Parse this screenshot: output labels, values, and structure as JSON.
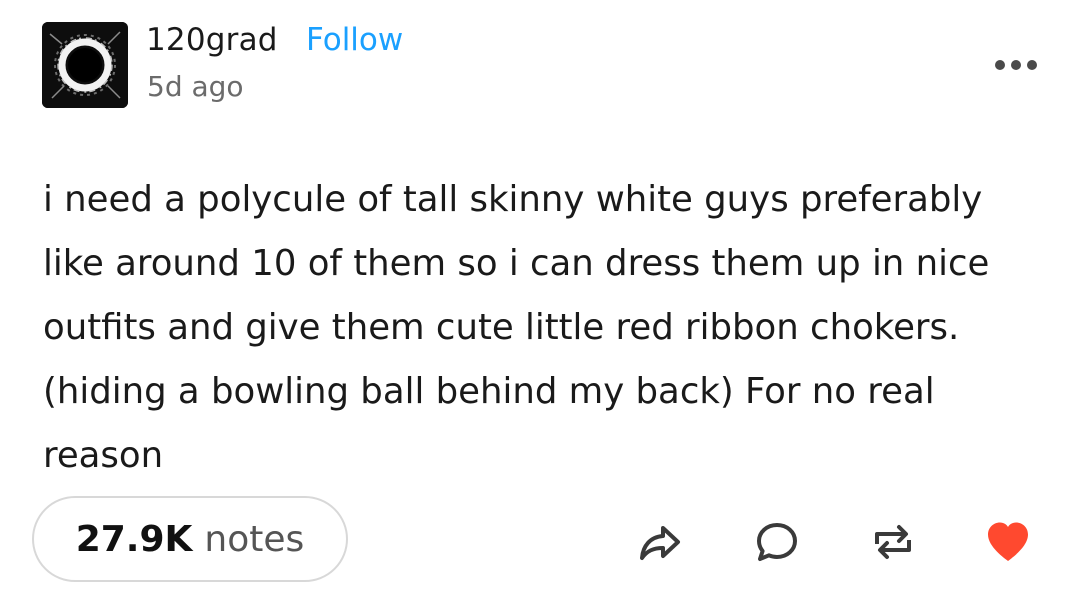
{
  "post": {
    "author": "120grad",
    "follow_label": "Follow",
    "timestamp": "5d ago",
    "body": "i need a polycule of tall skinny white guys preferably like around 10 of them so i can dress them up in nice outfits and give them cute little red ribbon chokers. (hiding a bowling ball behind my back) For no real reason"
  },
  "notes": {
    "count": "27.9K",
    "label": "notes"
  },
  "icons": {
    "avatar": "eclipse-ring-avatar",
    "more": "more-options-icon",
    "share": "share-icon",
    "reply": "reply-icon",
    "reblog": "reblog-icon",
    "like": "heart-icon"
  },
  "colors": {
    "follow": "#1aa0ff",
    "like": "#ff492f",
    "text": "#1a1a1a",
    "muted": "#6b6b6b"
  }
}
